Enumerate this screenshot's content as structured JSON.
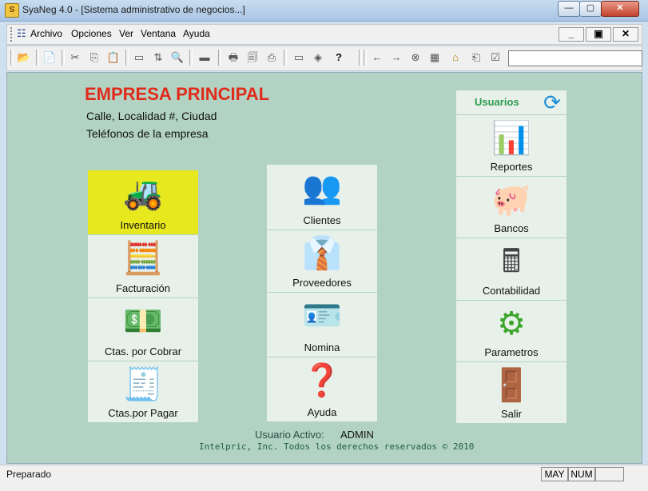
{
  "window": {
    "title": "SyaNeg 4.0 - [Sistema administrativo de negocios...]",
    "app_icon": "S",
    "min_label": "—",
    "max_label": "▢",
    "close_label": "✕"
  },
  "menu": {
    "items": [
      "Archivo",
      "Opciones",
      "Ver",
      "Ventana",
      "Ayuda"
    ],
    "mdi_min": "_",
    "mdi_restore": "▣",
    "mdi_close": "✕"
  },
  "toolbar": {
    "icons": [
      "📂",
      "📄",
      "✂",
      "⎘",
      "📋",
      "▭",
      "⇅",
      "🔍",
      "▬",
      "🖶",
      "🗐",
      "⎙",
      "▭",
      "◈",
      "?",
      "←",
      "→",
      "⊗",
      "▦",
      "⌂",
      "⎗",
      "☑"
    ]
  },
  "company": {
    "name": "EMPRESA PRINCIPAL",
    "address": "Calle, Localidad #, Ciudad",
    "phones": "Teléfonos de la empresa"
  },
  "modules": {
    "left": [
      {
        "label": "Inventario",
        "icon": "forklift-icon",
        "glyph": "🚜"
      },
      {
        "label": "Facturación",
        "icon": "cash-register-icon",
        "glyph": "🧮"
      },
      {
        "label": "Ctas. por Cobrar",
        "icon": "money-stack-icon",
        "glyph": "💵"
      },
      {
        "label": "Ctas.por Pagar",
        "icon": "checkbook-icon",
        "glyph": "🧾"
      }
    ],
    "middle": [
      {
        "label": "Clientes",
        "icon": "clients-icon",
        "glyph": "👥"
      },
      {
        "label": "Proveedores",
        "icon": "supplier-icon",
        "glyph": "👔"
      },
      {
        "label": "Nomina",
        "icon": "id-card-icon",
        "glyph": "🪪"
      },
      {
        "label": "Ayuda",
        "icon": "help-shield-icon",
        "glyph": "❓"
      }
    ],
    "right_header": {
      "label": "Usuarios",
      "icon": "refresh-icon",
      "glyph": "⟳"
    },
    "right": [
      {
        "label": "Reportes",
        "icon": "bar-chart-icon",
        "glyph": "📊"
      },
      {
        "label": "Bancos",
        "icon": "piggy-bank-icon",
        "glyph": "🐖"
      },
      {
        "label": "Contabilidad",
        "icon": "calculator-icon",
        "glyph": "🖩"
      },
      {
        "label": "Parametros",
        "icon": "gear-icon",
        "glyph": "⚙"
      },
      {
        "label": "Salir",
        "icon": "exit-door-icon",
        "glyph": "🚪"
      }
    ]
  },
  "footer": {
    "user_label": "Usuario Activo:",
    "user_value": "ADMIN",
    "copyright": "Intelpric, Inc. Todos los derechos reservados  © 2010"
  },
  "status": {
    "text": "Preparado",
    "may": "MAY",
    "num": "NUM",
    "extra": ""
  },
  "colors": {
    "panel_bg": "#b2d3c4",
    "tile_bg": "#e8f0ea",
    "selected_tile": "#e8e81e",
    "company_name": "#e02b1b",
    "usuarios": "#2c9a4a"
  }
}
